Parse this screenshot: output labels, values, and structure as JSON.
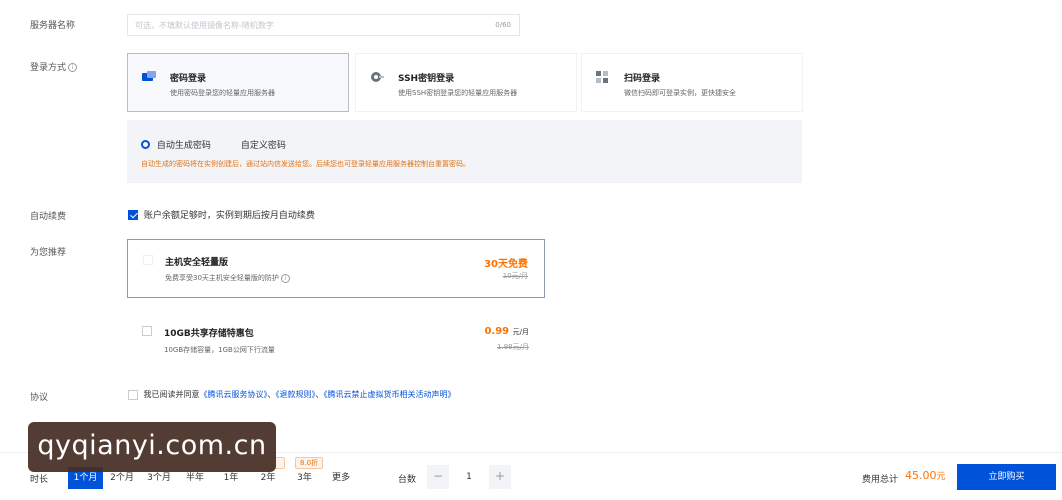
{
  "server_name": {
    "label": "服务器名称",
    "placeholder": "可选，不填默认使用镜像名称-随机数字",
    "counter": "0/60"
  },
  "login_method": {
    "label": "登录方式",
    "info_icon": "i",
    "options": [
      {
        "title": "密码登录",
        "desc": "使用密码登录您的轻量应用服务器",
        "icon": "password-icon",
        "selected": true
      },
      {
        "title": "SSH密钥登录",
        "desc": "使用SSH密钥登录您的轻量应用服务器",
        "icon": "ssh-key-icon",
        "selected": false
      },
      {
        "title": "扫码登录",
        "desc": "微信扫码即可登录实例，更快捷安全",
        "icon": "qr-code-icon",
        "selected": false
      }
    ],
    "password": {
      "auto_label": "自动生成密码",
      "custom_label": "自定义密码",
      "auto_selected": true,
      "notice": "自动生成的密码将在实例创建后，通过站内信发送给您。后续您也可登录轻量应用服务器控制台重置密码。"
    }
  },
  "auto_renew": {
    "label": "自动续费",
    "text": "账户余额足够时，实例到期后按月自动续费",
    "checked": true
  },
  "recommend": {
    "label": "为您推荐",
    "items": [
      {
        "title": "主机安全轻量版",
        "desc": "免费享受30天主机安全轻量版的防护",
        "price": "30天免费",
        "unit": "",
        "original": "10元/月",
        "selected": true
      },
      {
        "title": "10GB共享存储特惠包",
        "desc": "10GB存储容量，1GB公网下行流量",
        "price": "0.99",
        "unit": "元/月",
        "original": "1.98元/月",
        "selected": false
      }
    ]
  },
  "agreement": {
    "label": "协议",
    "prefix": "我已阅读并同意",
    "link1": "《腾讯云服务协议》",
    "sep1": "、",
    "link2": "《退款规则》",
    "sep2": "、",
    "link3": "《腾讯云禁止虚拟货币相关活动声明》",
    "checked": false
  },
  "bottom": {
    "duration_label": "时长",
    "durations": [
      "1个月",
      "2个月",
      "3个月",
      "半年",
      "1年",
      "2年",
      "3年",
      "更多"
    ],
    "active_duration": "1个月",
    "tags": [
      "",
      "8.0折"
    ],
    "quantity_label": "台数",
    "quantity": "1",
    "minus": "−",
    "plus": "+",
    "total_label": "费用总计",
    "total": "45.00",
    "total_unit": "元",
    "buy_label": "立即购买"
  },
  "watermark": "qyqianyi.com.cn",
  "colors": {
    "primary": "#0052d9",
    "price": "#ff7200",
    "notice": "#e37318"
  }
}
